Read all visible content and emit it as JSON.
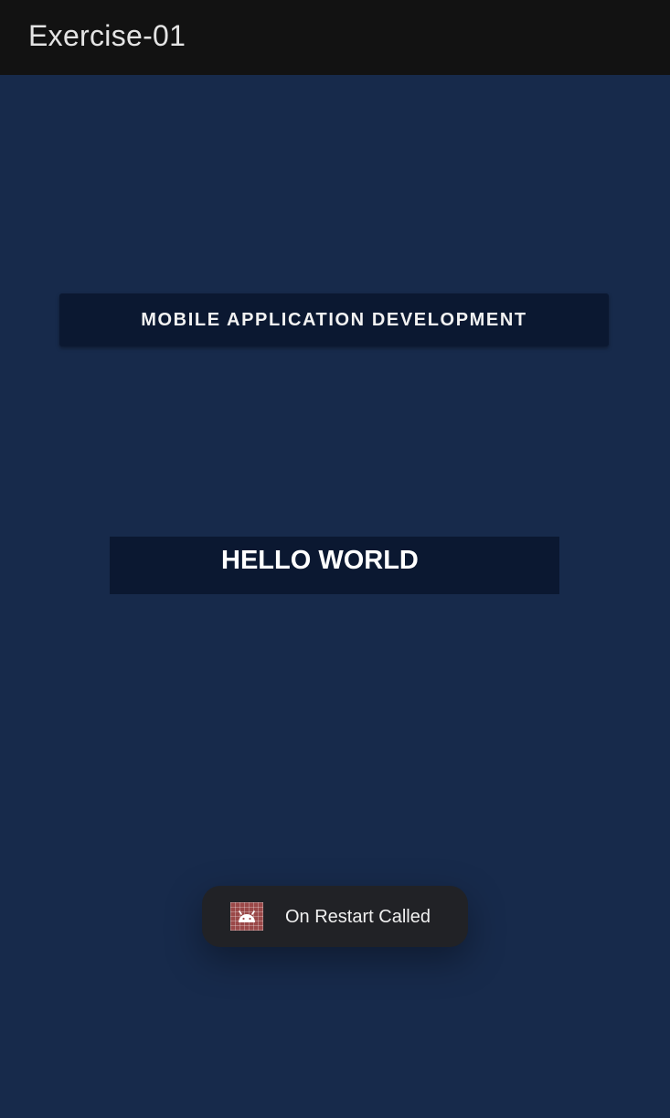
{
  "app_bar": {
    "title": "Exercise-01"
  },
  "main": {
    "course_button_label": "MOBILE APPLICATION DEVELOPMENT",
    "hello_text": "HELLO WORLD"
  },
  "toast": {
    "icon": "android-app-icon",
    "message": "On Restart Called"
  },
  "colors": {
    "app_bar_background": "#121212",
    "screen_background": "#172a4b",
    "button_background": "#0b1831",
    "toast_background": "#212226"
  }
}
